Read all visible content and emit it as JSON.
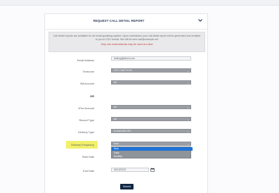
{
  "header": {
    "title": "REQUEST CALL DETAIL REPORT"
  },
  "info": {
    "text": "Call detail reports are available for all email-speaking system. Upon submission your call detail report will be generated and emailed to you in CSV format. We will be here.call@example.net",
    "warning": "Only one email address may be used at a time"
  },
  "form": {
    "email": {
      "label": "Email Address",
      "value": "testing@jdtech.com"
    },
    "timezone": {
      "label": "Timezone",
      "value": "UTC / GMT+0:00"
    },
    "bill_account": {
      "label": "Bill Account",
      "value": "All"
    },
    "or_label": "OR",
    "vfax_account": {
      "label": "vFax Account",
      "value": "All"
    },
    "record_type": {
      "label": "Record Type",
      "value": "All"
    },
    "delivery_type": {
      "label": "Delivery Type",
      "value": "E-mail with CSV"
    },
    "delivery_frequency": {
      "label": "Delivery Frequency",
      "value": "Now",
      "options": [
        "Now",
        "Daily",
        "Monthly"
      ]
    },
    "start_date": {
      "label": "Start Date"
    },
    "end_date": {
      "label": "End Date",
      "value": "06/13/2023"
    },
    "submit_label": "Submit"
  },
  "colors": {
    "accent": "#1d73d9",
    "submit": "#0f2745",
    "highlight": "#f2f06a",
    "warning": "#c0413b"
  }
}
